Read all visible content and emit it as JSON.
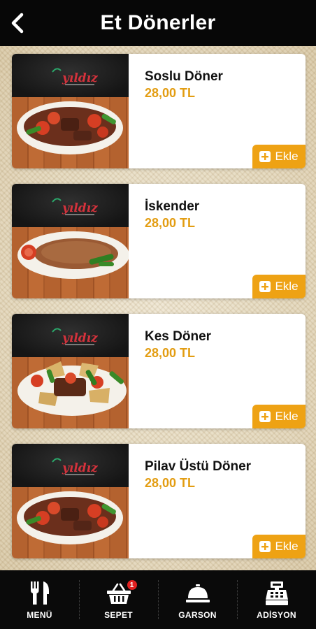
{
  "header": {
    "title": "Et Dönerler"
  },
  "items": [
    {
      "name": "Soslu Döner",
      "price": "28,00 TL",
      "add_label": "Ekle"
    },
    {
      "name": "İskender",
      "price": "28,00 TL",
      "add_label": "Ekle"
    },
    {
      "name": "Kes Döner",
      "price": "28,00 TL",
      "add_label": "Ekle"
    },
    {
      "name": "Pilav Üstü Döner",
      "price": "28,00 TL",
      "add_label": "Ekle"
    }
  ],
  "logo_text": "yıldız",
  "bottom_nav": [
    {
      "label": "MENÜ",
      "icon": "fork-knife-icon"
    },
    {
      "label": "SEPET",
      "icon": "basket-icon",
      "badge": "1"
    },
    {
      "label": "GARSON",
      "icon": "service-bell-icon"
    },
    {
      "label": "ADİSYON",
      "icon": "cash-register-icon"
    }
  ],
  "colors": {
    "accent": "#eea214",
    "price": "#e39d12",
    "header_bg": "#070707",
    "badge": "#e12020"
  }
}
